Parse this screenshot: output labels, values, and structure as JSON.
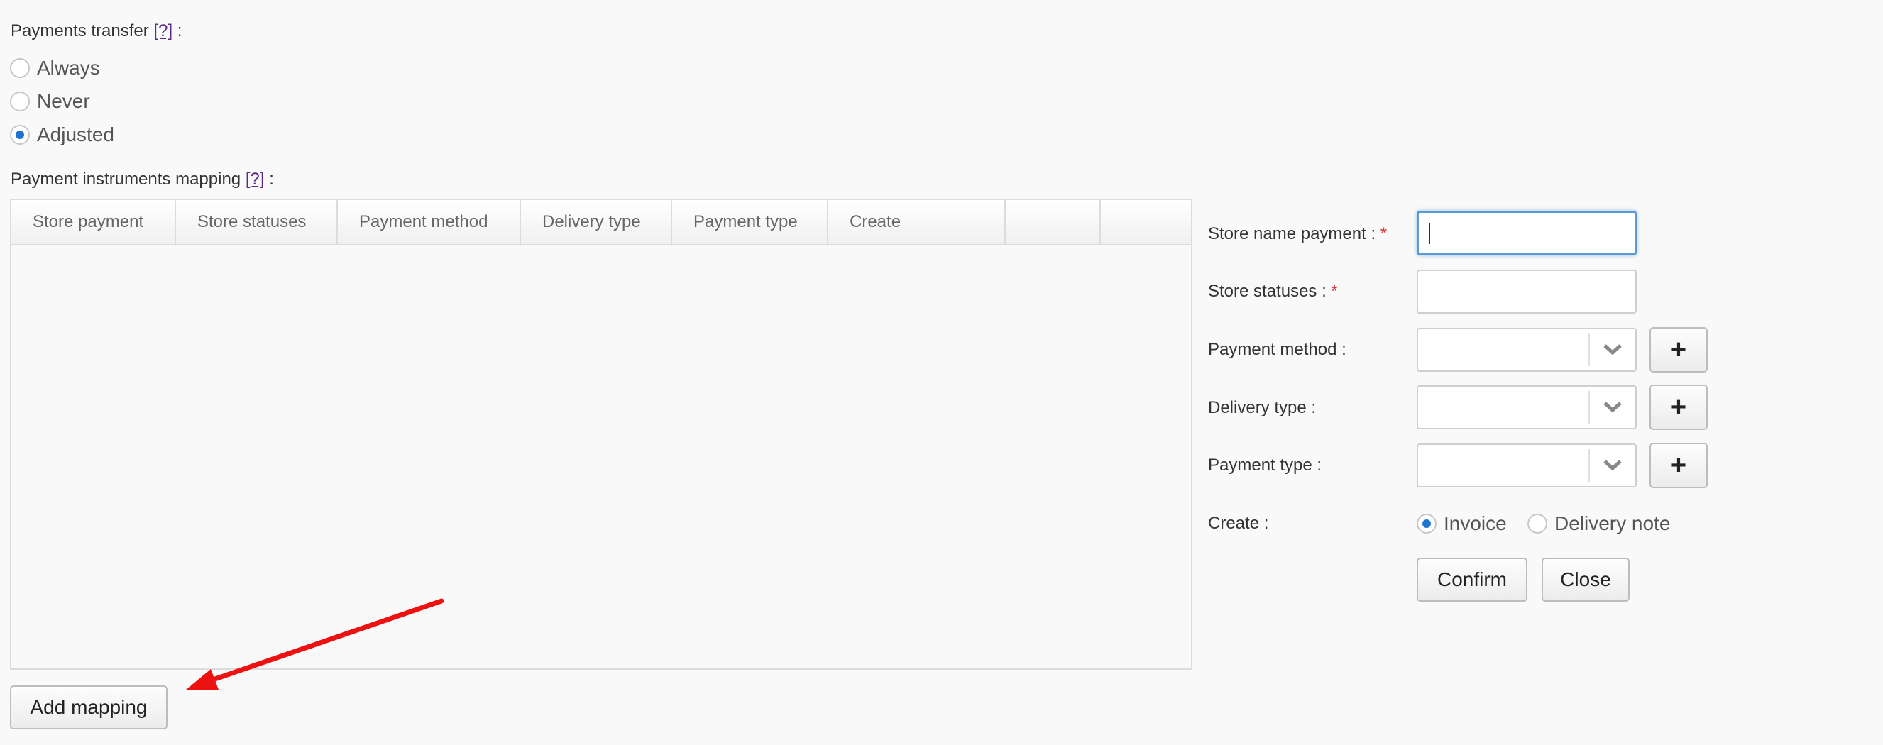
{
  "payments_transfer": {
    "label": "Payments transfer",
    "help": "[?]",
    "colon": ":",
    "options": [
      {
        "label": "Always",
        "checked": false
      },
      {
        "label": "Never",
        "checked": false
      },
      {
        "label": "Adjusted",
        "checked": true
      }
    ]
  },
  "mapping": {
    "label": "Payment instruments mapping",
    "help": "[?]",
    "colon": ":",
    "columns": [
      "Store payment",
      "Store statuses",
      "Payment method",
      "Delivery type",
      "Payment type",
      "Create",
      "",
      ""
    ],
    "rows": [],
    "add_button": "Add mapping"
  },
  "form": {
    "store_name_payment": {
      "label": "Store name payment :",
      "required": "*",
      "value": ""
    },
    "store_statuses": {
      "label": "Store statuses :",
      "required": "*",
      "value": ""
    },
    "payment_method": {
      "label": "Payment method :",
      "value": "",
      "add": "+"
    },
    "delivery_type": {
      "label": "Delivery type :",
      "value": "",
      "add": "+"
    },
    "payment_type": {
      "label": "Payment type :",
      "value": "",
      "add": "+"
    },
    "create": {
      "label": "Create :",
      "options": [
        {
          "label": "Invoice",
          "checked": true
        },
        {
          "label": "Delivery note",
          "checked": false
        }
      ]
    },
    "confirm": "Confirm",
    "close": "Close"
  },
  "colors": {
    "accent": "#1f74d1",
    "required": "#dd3333",
    "arrow": "#ee1111",
    "link": "#5b2a86"
  }
}
